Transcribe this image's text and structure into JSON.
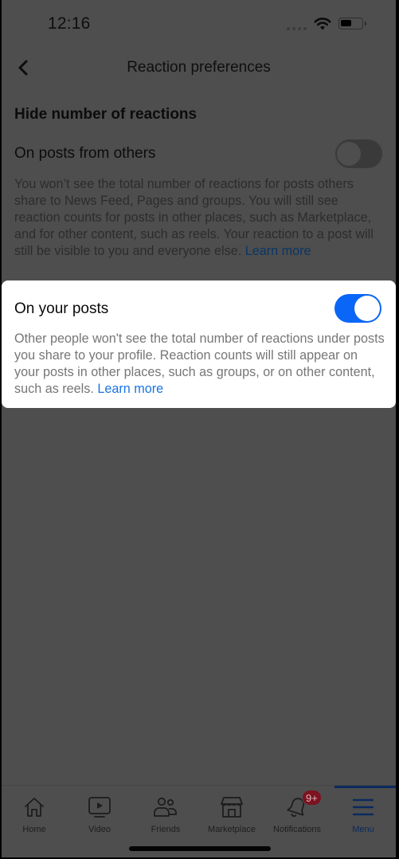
{
  "status_bar": {
    "time": "12:16",
    "icons": [
      "cellular-signal-icon",
      "wifi-icon",
      "battery-icon"
    ]
  },
  "nav": {
    "back_icon": "chevron-left-icon",
    "title": "Reaction preferences"
  },
  "section": {
    "title": "Hide number of reactions"
  },
  "settings": [
    {
      "label": "On posts from others",
      "enabled": false,
      "description": "You won’t see the total number of reactions for posts others share to News Feed, Pages and groups. You will still see reaction counts for posts in other places, such as Marketplace, and for other content, such as reels. Your reaction to a post will still be visible to you and everyone else.",
      "link": "Learn more"
    },
    {
      "label": "On your posts",
      "enabled": true,
      "description": "Other people won't see the total number of reactions under posts you share to your profile. Reaction counts will still appear on your posts in other places, such as groups, or on other content, such as reels.",
      "link": "Learn more"
    }
  ],
  "tab_bar": {
    "items": [
      {
        "label": "Home",
        "icon": "home-icon",
        "active": false
      },
      {
        "label": "Video",
        "icon": "video-icon",
        "active": false
      },
      {
        "label": "Friends",
        "icon": "friends-icon",
        "active": false
      },
      {
        "label": "Marketplace",
        "icon": "marketplace-icon",
        "active": false
      },
      {
        "label": "Notifications",
        "icon": "bell-icon",
        "active": false,
        "badge": "9+"
      },
      {
        "label": "Menu",
        "icon": "menu-icon",
        "active": true
      }
    ]
  },
  "colors": {
    "accent": "#1b74e4",
    "toggle_on": "#0a66f7",
    "badge": "#e41e3f",
    "overlay_dim": "#4e4e4e"
  }
}
